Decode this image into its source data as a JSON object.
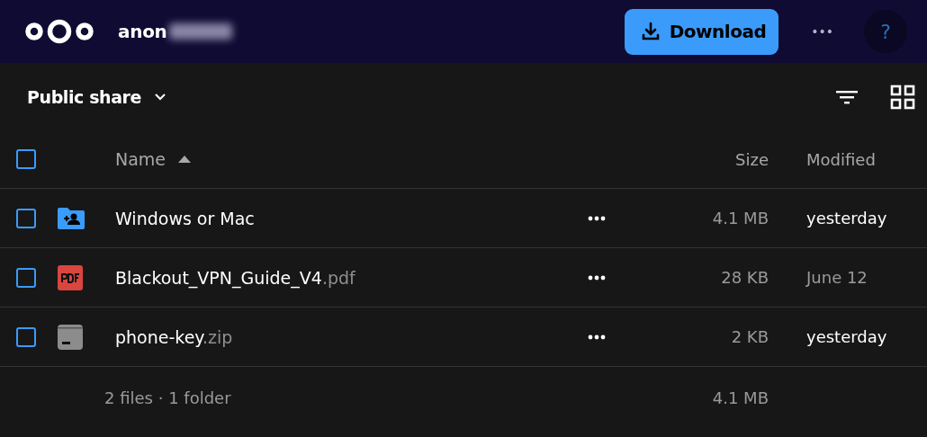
{
  "header": {
    "user": "anon",
    "download_button": "Download",
    "more_button": "•••",
    "help_button": "?"
  },
  "toolbar": {
    "title": "Public share"
  },
  "table": {
    "columns": {
      "name": "Name",
      "size": "Size",
      "modified": "Modified"
    },
    "select_all_checked": false,
    "sort_ascending": true,
    "rows": [
      {
        "kind": "shared-folder",
        "name": "Windows or Mac",
        "extension": "",
        "size": "4.1 MB",
        "modified": "yesterday",
        "recent": true,
        "checked": false
      },
      {
        "kind": "pdf",
        "name": "Blackout_VPN_Guide_V4",
        "extension": ".pdf",
        "size": "28 KB",
        "modified": "June 12",
        "recent": false,
        "checked": false
      },
      {
        "kind": "archive",
        "name": "phone-key",
        "extension": ".zip",
        "size": "2 KB",
        "modified": "yesterday",
        "recent": true,
        "checked": false
      }
    ],
    "footer": {
      "summary": "2 files · 1 folder",
      "size": "4.1 MB"
    }
  }
}
